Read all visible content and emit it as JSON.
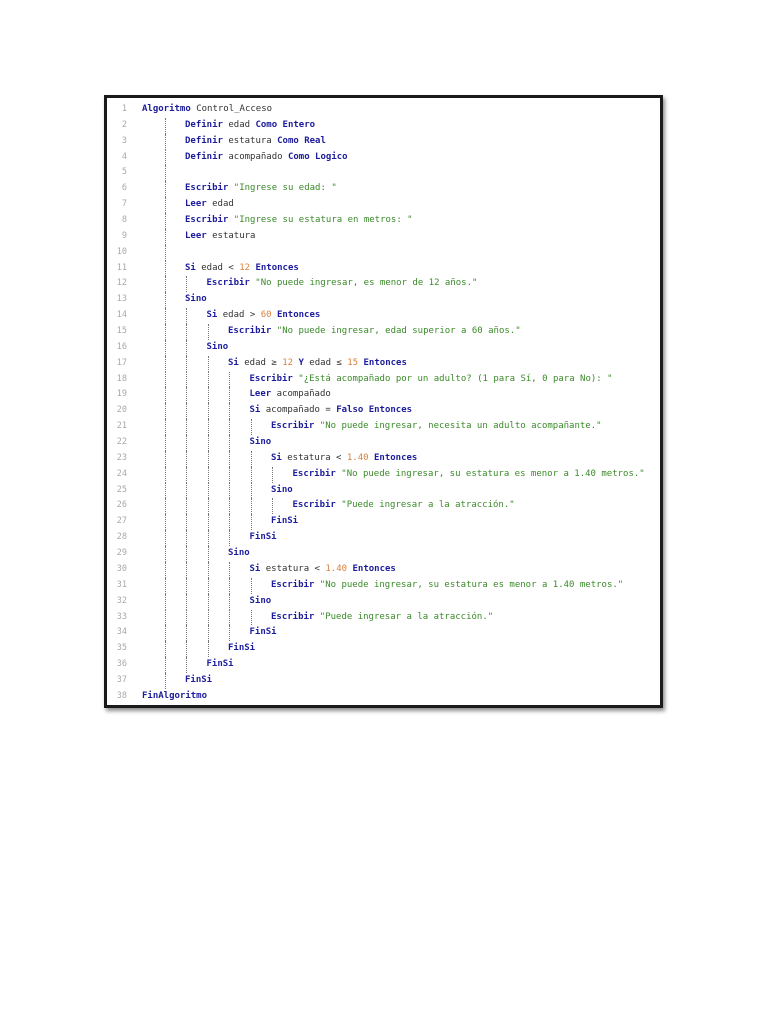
{
  "editor": {
    "colors": {
      "keyword": "#1c1c9c",
      "identifier": "#333333",
      "string": "#3b8a2a",
      "number": "#d9803e",
      "line_number": "#a8a8a8"
    },
    "lines": [
      {
        "n": "1",
        "indent": 0,
        "tokens": [
          [
            "kw",
            "Algoritmo"
          ],
          [
            "id",
            " Control_Acceso"
          ]
        ]
      },
      {
        "n": "2",
        "indent": 2,
        "tokens": [
          [
            "kw",
            "Definir"
          ],
          [
            "id",
            " edad "
          ],
          [
            "kw",
            "Como Entero"
          ]
        ]
      },
      {
        "n": "3",
        "indent": 2,
        "tokens": [
          [
            "kw",
            "Definir"
          ],
          [
            "id",
            " estatura "
          ],
          [
            "kw",
            "Como Real"
          ]
        ]
      },
      {
        "n": "4",
        "indent": 2,
        "tokens": [
          [
            "kw",
            "Definir"
          ],
          [
            "id",
            " acompañado "
          ],
          [
            "kw",
            "Como Logico"
          ]
        ]
      },
      {
        "n": "5",
        "indent": 2,
        "tokens": []
      },
      {
        "n": "6",
        "indent": 2,
        "tokens": [
          [
            "kw",
            "Escribir"
          ],
          [
            "id",
            " "
          ],
          [
            "str",
            "\"Ingrese su edad: \""
          ]
        ]
      },
      {
        "n": "7",
        "indent": 2,
        "tokens": [
          [
            "kw",
            "Leer"
          ],
          [
            "id",
            " edad"
          ]
        ]
      },
      {
        "n": "8",
        "indent": 2,
        "tokens": [
          [
            "kw",
            "Escribir"
          ],
          [
            "id",
            " "
          ],
          [
            "str",
            "\"Ingrese su estatura en metros: \""
          ]
        ]
      },
      {
        "n": "9",
        "indent": 2,
        "tokens": [
          [
            "kw",
            "Leer"
          ],
          [
            "id",
            " estatura"
          ]
        ]
      },
      {
        "n": "10",
        "indent": 2,
        "tokens": []
      },
      {
        "n": "11",
        "indent": 2,
        "tokens": [
          [
            "kw",
            "Si"
          ],
          [
            "id",
            " edad < "
          ],
          [
            "num",
            "12"
          ],
          [
            "id",
            " "
          ],
          [
            "kw",
            "Entonces"
          ]
        ]
      },
      {
        "n": "12",
        "indent": 3,
        "tokens": [
          [
            "kw",
            "Escribir"
          ],
          [
            "id",
            " "
          ],
          [
            "str",
            "\"No puede ingresar, es menor de 12 años.\""
          ]
        ]
      },
      {
        "n": "13",
        "indent": 2,
        "tokens": [
          [
            "kw",
            "Sino"
          ]
        ]
      },
      {
        "n": "14",
        "indent": 3,
        "tokens": [
          [
            "kw",
            "Si"
          ],
          [
            "id",
            " edad > "
          ],
          [
            "num",
            "60"
          ],
          [
            "id",
            " "
          ],
          [
            "kw",
            "Entonces"
          ]
        ]
      },
      {
        "n": "15",
        "indent": 4,
        "tokens": [
          [
            "kw",
            "Escribir"
          ],
          [
            "id",
            " "
          ],
          [
            "str",
            "\"No puede ingresar, edad superior a 60 años.\""
          ]
        ]
      },
      {
        "n": "16",
        "indent": 3,
        "tokens": [
          [
            "kw",
            "Sino"
          ]
        ]
      },
      {
        "n": "17",
        "indent": 4,
        "tokens": [
          [
            "kw",
            "Si"
          ],
          [
            "id",
            " edad ≥ "
          ],
          [
            "num",
            "12"
          ],
          [
            "id",
            " "
          ],
          [
            "kw",
            "Y"
          ],
          [
            "id",
            " edad ≤ "
          ],
          [
            "num",
            "15"
          ],
          [
            "id",
            " "
          ],
          [
            "kw",
            "Entonces"
          ]
        ]
      },
      {
        "n": "18",
        "indent": 5,
        "tokens": [
          [
            "kw",
            "Escribir"
          ],
          [
            "id",
            " "
          ],
          [
            "str",
            "\"¿Está acompañado por un adulto? (1 para Sí, 0 para No): \""
          ]
        ]
      },
      {
        "n": "19",
        "indent": 5,
        "tokens": [
          [
            "kw",
            "Leer"
          ],
          [
            "id",
            " acompañado"
          ]
        ]
      },
      {
        "n": "20",
        "indent": 5,
        "tokens": [
          [
            "kw",
            "Si"
          ],
          [
            "id",
            " acompañado = "
          ],
          [
            "kw",
            "Falso Entonces"
          ]
        ]
      },
      {
        "n": "21",
        "indent": 6,
        "tokens": [
          [
            "kw",
            "Escribir"
          ],
          [
            "id",
            " "
          ],
          [
            "str",
            "\"No puede ingresar, necesita un adulto acompañante.\""
          ]
        ]
      },
      {
        "n": "22",
        "indent": 5,
        "tokens": [
          [
            "kw",
            "Sino"
          ]
        ]
      },
      {
        "n": "23",
        "indent": 6,
        "tokens": [
          [
            "kw",
            "Si"
          ],
          [
            "id",
            " estatura < "
          ],
          [
            "num",
            "1.40"
          ],
          [
            "id",
            " "
          ],
          [
            "kw",
            "Entonces"
          ]
        ]
      },
      {
        "n": "24",
        "indent": 7,
        "tokens": [
          [
            "kw",
            "Escribir"
          ],
          [
            "id",
            " "
          ],
          [
            "str",
            "\"No puede ingresar, su estatura es menor a 1.40 metros.\""
          ]
        ]
      },
      {
        "n": "25",
        "indent": 6,
        "tokens": [
          [
            "kw",
            "Sino"
          ]
        ]
      },
      {
        "n": "26",
        "indent": 7,
        "tokens": [
          [
            "kw",
            "Escribir"
          ],
          [
            "id",
            " "
          ],
          [
            "str",
            "\"Puede ingresar a la atracción.\""
          ]
        ]
      },
      {
        "n": "27",
        "indent": 6,
        "tokens": [
          [
            "kw",
            "FinSi"
          ]
        ]
      },
      {
        "n": "28",
        "indent": 5,
        "tokens": [
          [
            "kw",
            "FinSi"
          ]
        ]
      },
      {
        "n": "29",
        "indent": 4,
        "tokens": [
          [
            "kw",
            "Sino"
          ]
        ]
      },
      {
        "n": "30",
        "indent": 5,
        "tokens": [
          [
            "kw",
            "Si"
          ],
          [
            "id",
            " estatura < "
          ],
          [
            "num",
            "1.40"
          ],
          [
            "id",
            " "
          ],
          [
            "kw",
            "Entonces"
          ]
        ]
      },
      {
        "n": "31",
        "indent": 6,
        "tokens": [
          [
            "kw",
            "Escribir"
          ],
          [
            "id",
            " "
          ],
          [
            "str",
            "\"No puede ingresar, su estatura es menor a 1.40 metros.\""
          ]
        ]
      },
      {
        "n": "32",
        "indent": 5,
        "tokens": [
          [
            "kw",
            "Sino"
          ]
        ]
      },
      {
        "n": "33",
        "indent": 6,
        "tokens": [
          [
            "kw",
            "Escribir"
          ],
          [
            "id",
            " "
          ],
          [
            "str",
            "\"Puede ingresar a la atracción.\""
          ]
        ]
      },
      {
        "n": "34",
        "indent": 5,
        "tokens": [
          [
            "kw",
            "FinSi"
          ]
        ]
      },
      {
        "n": "35",
        "indent": 4,
        "tokens": [
          [
            "kw",
            "FinSi"
          ]
        ]
      },
      {
        "n": "36",
        "indent": 3,
        "tokens": [
          [
            "kw",
            "FinSi"
          ]
        ]
      },
      {
        "n": "37",
        "indent": 2,
        "tokens": [
          [
            "kw",
            "FinSi"
          ]
        ]
      },
      {
        "n": "38",
        "indent": 0,
        "tokens": [
          [
            "kw",
            "FinAlgoritmo"
          ]
        ]
      }
    ]
  }
}
